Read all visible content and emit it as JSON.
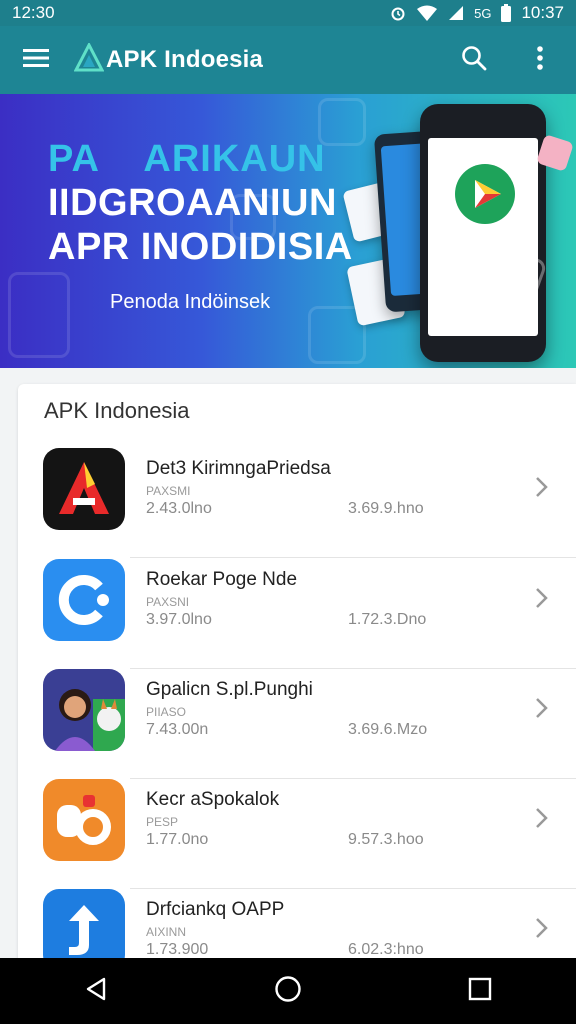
{
  "status_bar": {
    "left_time": "12:30",
    "signal_text": "5G",
    "right_time": "10:37"
  },
  "app_bar": {
    "title": "APK Indoesia",
    "icons": [
      "menu-icon",
      "search-icon",
      "more-vert-icon"
    ]
  },
  "banner": {
    "line_top": "PA    ARIKAUN",
    "line_1": "IIDGROAANIUN",
    "line_2": "APR INODIDISIA",
    "subtitle": "Penoda Indöinsek",
    "colors": {
      "start": "#3b2ec4",
      "end": "#2cc8b6",
      "accent": "#35c3e8"
    }
  },
  "list": {
    "title": "APK Indonesia",
    "items": [
      {
        "name": "Det3 KirimngaPriedsa",
        "developer": "PAXSMI",
        "size": "2.43.0lno",
        "downloads": "3.69.9.hno",
        "icon": "red-a-icon"
      },
      {
        "name": "Roekar Poge Nde",
        "developer": "PAXSNI",
        "size": "3.97.0lno",
        "downloads": "1.72.3.Dno",
        "icon": "blue-c-icon"
      },
      {
        "name": "Gpalicn S.pl.Punghi",
        "developer": "PIIASO",
        "size": "7.43.00n",
        "downloads": "3.69.6.Mzo",
        "icon": "avatar-dog-icon"
      },
      {
        "name": "Kecr aSpokalok",
        "developer": "PESP",
        "size": "1.77.0no",
        "downloads": "9.57.3.hoo",
        "icon": "orange-lock-icon"
      },
      {
        "name": "Drfciankq OAPP",
        "developer": "AIXINN",
        "size": "1.73.900",
        "downloads": "6.02.3:hno",
        "icon": "blue-arrow-icon"
      }
    ]
  },
  "nav_bar": {
    "icons": [
      "back-icon",
      "home-icon",
      "recents-icon"
    ]
  }
}
